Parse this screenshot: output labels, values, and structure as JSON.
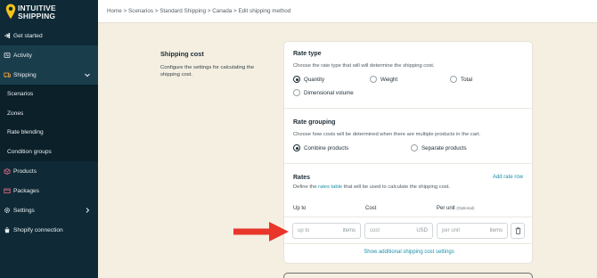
{
  "app": {
    "logo_line1": "INTUITIVE",
    "logo_line2": "SHIPPING"
  },
  "sidebar": {
    "items": [
      {
        "label": "Get started",
        "icon": "getting-started-icon"
      },
      {
        "label": "Activity",
        "icon": "activity-icon"
      },
      {
        "label": "Shipping",
        "icon": "shipping-box-icon"
      },
      {
        "label": "Scenarios"
      },
      {
        "label": "Zones"
      },
      {
        "label": "Rate blending"
      },
      {
        "label": "Condition groups"
      },
      {
        "label": "Products",
        "icon": "products-icon"
      },
      {
        "label": "Packages",
        "icon": "packages-icon"
      },
      {
        "label": "Settings",
        "icon": "gear-icon"
      },
      {
        "label": "Shopify connection",
        "icon": "shopify-connection-icon"
      }
    ]
  },
  "breadcrumb": {
    "items": [
      "Home",
      "Scenarios",
      "Standard Shipping",
      "Canada",
      "Edit shipping method"
    ],
    "separator": ">"
  },
  "section": {
    "title": "Shipping cost",
    "description": "Configure the settings for calculating the shipping cost."
  },
  "rate_type": {
    "title": "Rate type",
    "description": "Choose the rate type that will will determine the shipping cost.",
    "options": [
      "Quantity",
      "Weight",
      "Total",
      "Dimensional volume"
    ],
    "selected": "Quantity"
  },
  "rate_grouping": {
    "title": "Rate grouping",
    "description": "Choose how costs will be determined when there are multiple products in the cart.",
    "options": [
      "Combine products",
      "Separate products"
    ],
    "selected": "Combine products"
  },
  "rates": {
    "title": "Rates",
    "description_prefix": "Define the ",
    "description_link": "rates table",
    "description_suffix": " that will be used to calculate the shipping cost.",
    "add_row": "Add rate row",
    "columns": {
      "up_to": "Up to",
      "cost": "Cost",
      "per_unit": "Per unit",
      "per_unit_note": "(Optional)"
    },
    "row": {
      "up_to_placeholder": "up to",
      "up_to_unit": "items",
      "cost_placeholder": "cost",
      "cost_unit": "USD",
      "per_unit_placeholder": "per unit",
      "per_unit_unit": "items"
    },
    "show_more": "Show additional shipping cost settings"
  },
  "colors": {
    "sidebar_bg": "#0f2a36",
    "page_bg": "#f4efe1",
    "accent_link": "#1a8fa8",
    "logo_pin": "#f2c21b",
    "arrow": "#e8362b"
  }
}
